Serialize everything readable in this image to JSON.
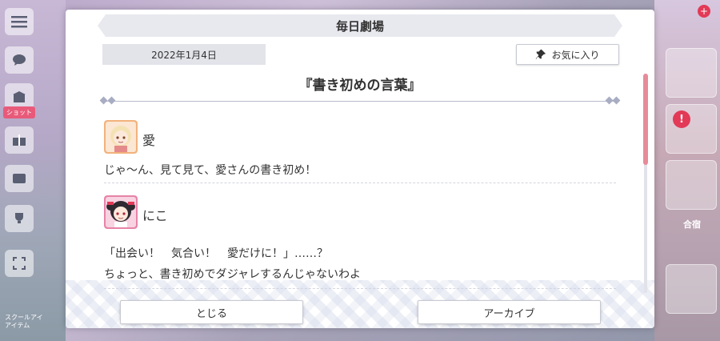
{
  "dialog": {
    "title": "毎日劇場",
    "date": "2022年1月4日",
    "favorite_label": "お気に入り",
    "story_title": "『書き初めの言葉』",
    "entries": [
      {
        "speaker": "愛",
        "lines": [
          "じゃ～ん、見て見て、愛さんの書き初め！"
        ]
      },
      {
        "speaker": "にこ",
        "lines": [
          "「出会い！　気合い！　愛だけに！」……？",
          "ちょっと、書き初めでダジャレするんじゃないわよ"
        ]
      }
    ],
    "close_label": "とじる",
    "archive_label": "アーカイブ"
  },
  "background": {
    "side_tag": "ショット",
    "side_text_1": "スクールアイ",
    "side_text_2": "アイテム",
    "right_label": "合宿",
    "badge": "!"
  },
  "colors": {
    "accent_scroll": "#e88b99",
    "badge_red": "#e23a57"
  }
}
